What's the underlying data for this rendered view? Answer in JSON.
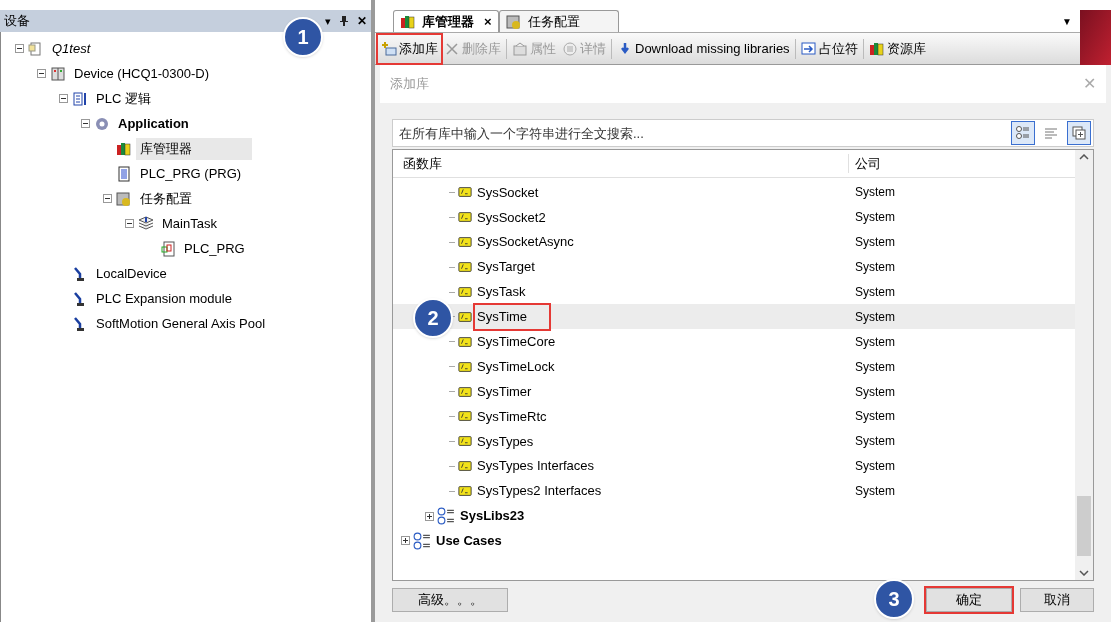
{
  "devices_panel": {
    "title": "设备",
    "menu_glyph": "▾",
    "close_glyph": "✕",
    "tree": [
      {
        "label": "Q1test",
        "kind": "project",
        "expanded": true,
        "selected": false,
        "children": [
          {
            "label": "Device (HCQ1-0300-D)",
            "kind": "device",
            "expanded": true,
            "selected": false,
            "children": [
              {
                "label": "PLC 逻辑",
                "kind": "logic",
                "expanded": true,
                "selected": false,
                "children": [
                  {
                    "label": "Application",
                    "kind": "application",
                    "expanded": true,
                    "selected": false,
                    "children": [
                      {
                        "label": "库管理器",
                        "kind": "libraries",
                        "selected": true
                      },
                      {
                        "label": "PLC_PRG (PRG)",
                        "kind": "program",
                        "selected": false
                      },
                      {
                        "label": "任务配置",
                        "kind": "taskconfig",
                        "expanded": true,
                        "selected": false,
                        "children": [
                          {
                            "label": "MainTask",
                            "kind": "task",
                            "expanded": true,
                            "selected": false,
                            "children": [
                              {
                                "label": "PLC_PRG",
                                "kind": "call",
                                "selected": false
                              }
                            ]
                          }
                        ]
                      }
                    ]
                  }
                ]
              },
              {
                "label": "LocalDevice",
                "kind": "axis",
                "selected": false
              },
              {
                "label": "PLC Expansion module",
                "kind": "axis",
                "selected": false
              },
              {
                "label": "SoftMotion General Axis Pool",
                "kind": "axis",
                "selected": false
              }
            ]
          }
        ]
      }
    ]
  },
  "editor_tabs": [
    {
      "label": "库管理器",
      "kind": "libraries",
      "selected": true,
      "close_glyph": "×"
    },
    {
      "label": "任务配置",
      "kind": "taskconfig",
      "selected": false
    }
  ],
  "tabs_menu_glyph": "▼",
  "toolbar": [
    {
      "label": "添加库",
      "kind": "add",
      "disabled": false,
      "highlighted": true,
      "callout": "1"
    },
    {
      "label": "删除库",
      "kind": "delete",
      "disabled": true,
      "highlighted": false
    },
    {
      "label": "属性",
      "kind": "props",
      "disabled": true,
      "highlighted": false
    },
    {
      "label": "详情",
      "kind": "details",
      "disabled": true,
      "highlighted": false
    },
    {
      "label": "Download missing libraries",
      "kind": "download",
      "disabled": false,
      "highlighted": false
    },
    {
      "label": "占位符",
      "kind": "placeholder",
      "disabled": false,
      "highlighted": false
    },
    {
      "label": "资源库",
      "kind": "libraries",
      "disabled": false,
      "highlighted": false
    }
  ],
  "dialog": {
    "title": "添加库",
    "close_glyph": "✕",
    "search": {
      "placeholder": "在所有库中输入一个字符串进行全文搜索..."
    },
    "view_buttons": [
      {
        "kind": "tree",
        "selected": true
      },
      {
        "kind": "list",
        "selected": false
      },
      {
        "kind": "expand",
        "selected": true
      }
    ],
    "columns": [
      "函数库",
      "公司"
    ],
    "library_tree": [
      {
        "children": [
          {
            "children": [
              {
                "name": "SysSocket",
                "company": "System",
                "selected": false,
                "highlighted": false
              },
              {
                "name": "SysSocket2",
                "company": "System",
                "selected": false,
                "highlighted": false
              },
              {
                "name": "SysSocketAsync",
                "company": "System",
                "selected": false,
                "highlighted": false
              },
              {
                "name": "SysTarget",
                "company": "System",
                "selected": false,
                "highlighted": false
              },
              {
                "name": "SysTask",
                "company": "System",
                "selected": false,
                "highlighted": false
              },
              {
                "name": "SysTime",
                "company": "System",
                "selected": true,
                "highlighted": true,
                "callout": "2"
              },
              {
                "name": "SysTimeCore",
                "company": "System",
                "selected": false,
                "highlighted": false
              },
              {
                "name": "SysTimeLock",
                "company": "System",
                "selected": false,
                "highlighted": false
              },
              {
                "name": "SysTimer",
                "company": "System",
                "selected": false,
                "highlighted": false
              },
              {
                "name": "SysTimeRtc",
                "company": "System",
                "selected": false,
                "highlighted": false
              },
              {
                "name": "SysTypes",
                "company": "System",
                "selected": false,
                "highlighted": false
              },
              {
                "name": "SysTypes Interfaces",
                "company": "System",
                "selected": false,
                "highlighted": false
              },
              {
                "name": "SysTypes2 Interfaces",
                "company": "System",
                "selected": false,
                "highlighted": false
              }
            ]
          },
          {
            "name": "SysLibs23",
            "expanded": false
          }
        ]
      },
      {
        "name": "Use Cases",
        "expanded": false
      }
    ],
    "advanced_button": "高级。。。",
    "ok_button": {
      "label": "确定",
      "highlighted": true,
      "callout": "3"
    },
    "cancel_button": "取消"
  }
}
